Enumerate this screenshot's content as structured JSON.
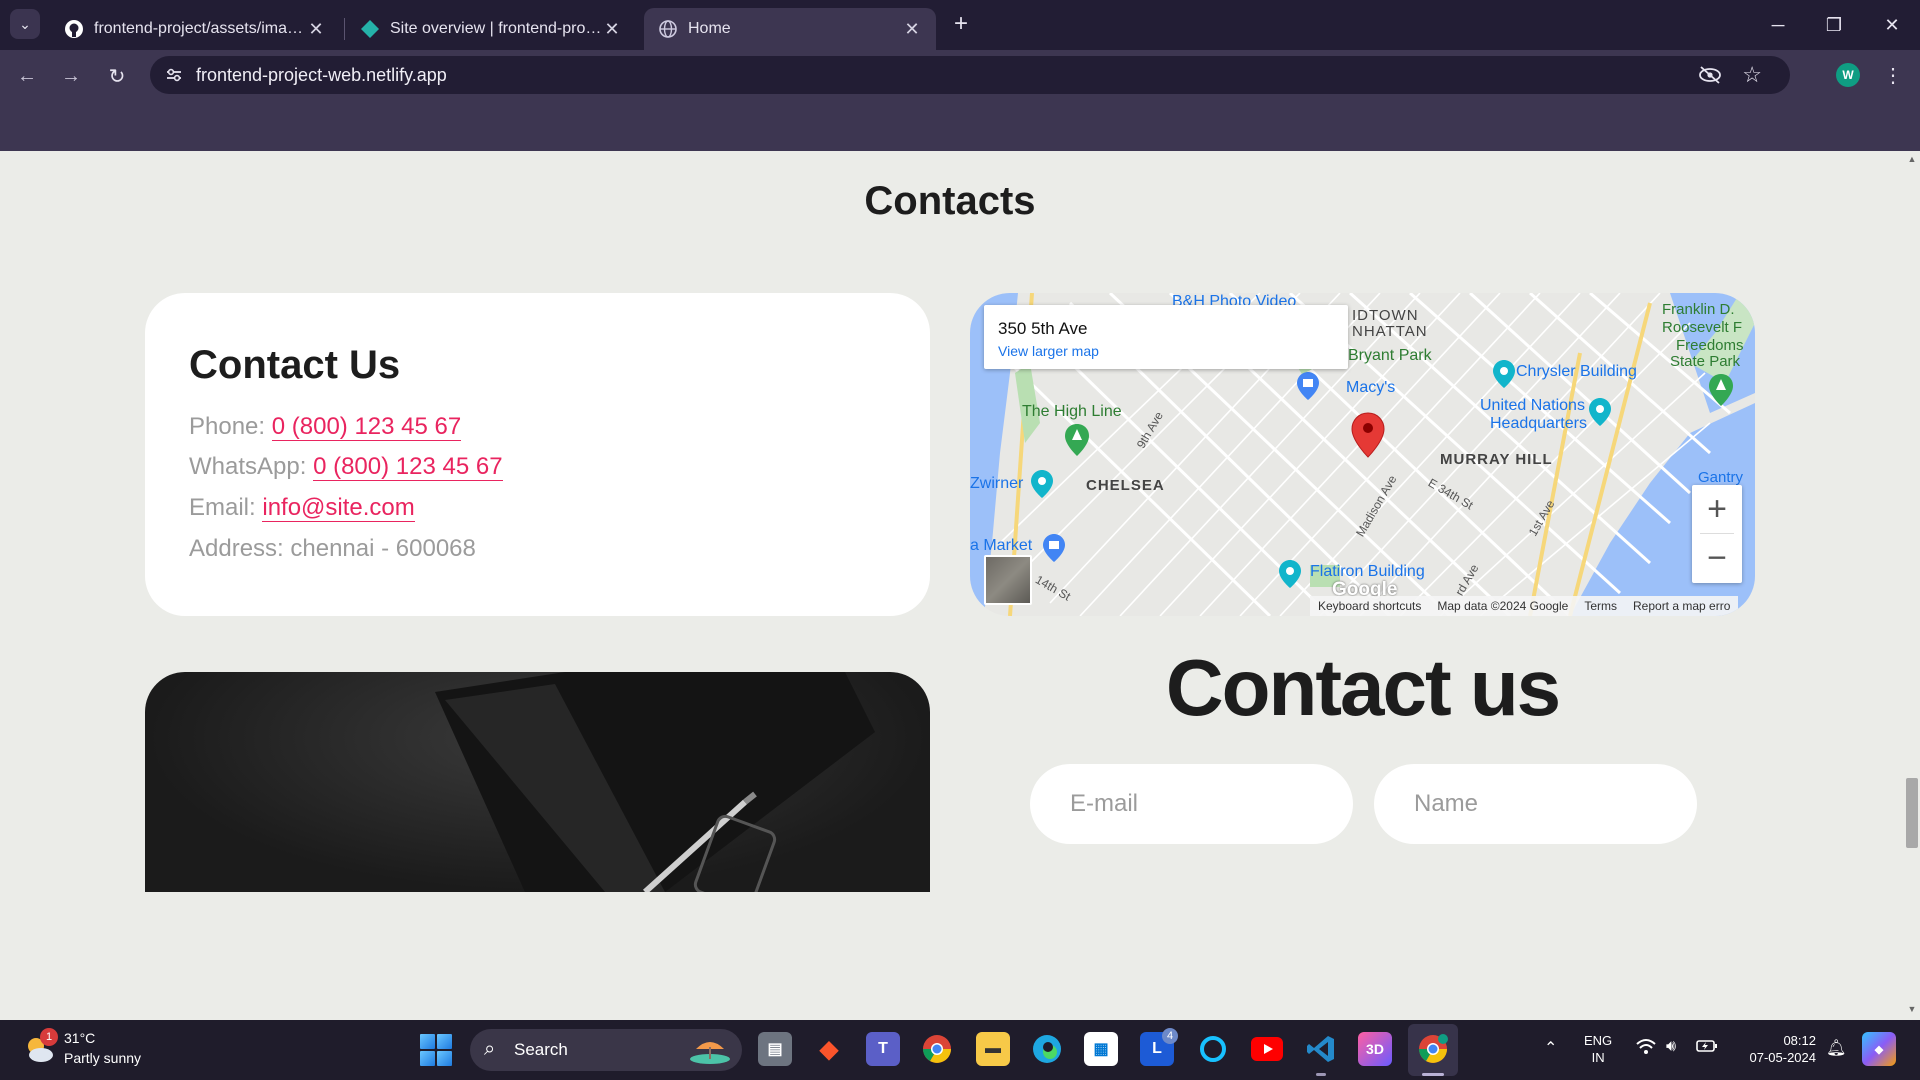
{
  "browser": {
    "tabs": [
      {
        "title": "frontend-project/assets/images",
        "favicon": "github-icon"
      },
      {
        "title": "Site overview | frontend-project",
        "favicon": "netlify-icon"
      },
      {
        "title": "Home",
        "favicon": "globe-icon",
        "active": true
      }
    ],
    "new_tab_symbol": "+",
    "url": "frontend-project-web.netlify.app",
    "profile_initial": "W"
  },
  "page": {
    "section_title": "Contacts",
    "contact_card": {
      "heading": "Contact Us",
      "phone_label": "Phone:",
      "phone": "0 (800) 123 45 67",
      "whatsapp_label": "WhatsApp:",
      "whatsapp": "0 (800) 123 45 67",
      "email_label": "Email:",
      "email": "info@site.com",
      "address": "Address: chennai - 600068"
    },
    "map": {
      "address": "350 5th Ave",
      "view_larger": "View larger map",
      "places": {
        "bh": "B&H Photo Video",
        "midtown": "IDTOWN",
        "manhattan": "NHATTAN",
        "bryant": "Bryant Park",
        "macys": "Macy's",
        "chrysler": "Chrysler Building",
        "un1": "United Nations",
        "un2": "Headquarters",
        "franklin1": "Franklin D.",
        "franklin2": "Roosevelt F",
        "franklin3": "Freedoms",
        "franklin4": "State Park",
        "highline": "The High Line",
        "murray": "MURRAY HILL",
        "zwirner": "Zwirner",
        "chelsea": "CHELSEA",
        "gantry1": "Gantry",
        "market": "a Market",
        "flatiron": "Flatiron Building",
        "ave9": "9th Ave",
        "madison": "Madison Ave",
        "e34": "E 34th St",
        "ave1": "1st Ave",
        "st14": "14th St",
        "ave3": "rd Ave"
      },
      "zoom_in": "+",
      "zoom_out": "−",
      "google": "Google",
      "footer": {
        "shortcuts": "Keyboard shortcuts",
        "mapdata": "Map data ©2024 Google",
        "terms": "Terms",
        "report": "Report a map erro"
      }
    },
    "form": {
      "title": "Contact us",
      "email_placeholder": "E-mail",
      "name_placeholder": "Name"
    }
  },
  "taskbar": {
    "weather_temp": "31°C",
    "weather_desc": "Partly sunny",
    "weather_badge": "1",
    "search_label": "Search",
    "lang_line1": "ENG",
    "lang_line2": "IN",
    "time": "08:12",
    "date": "07-05-2024",
    "apps": [
      "file-explorer-icon",
      "brave-icon",
      "teams-icon",
      "chrome-icon",
      "folder-icon",
      "edge-icon",
      "store-icon",
      "lens-icon",
      "cortana-icon",
      "youtube-icon",
      "vscode-icon",
      "3d-viewer-icon",
      "chrome-profile-icon"
    ],
    "badge_count": "4"
  }
}
